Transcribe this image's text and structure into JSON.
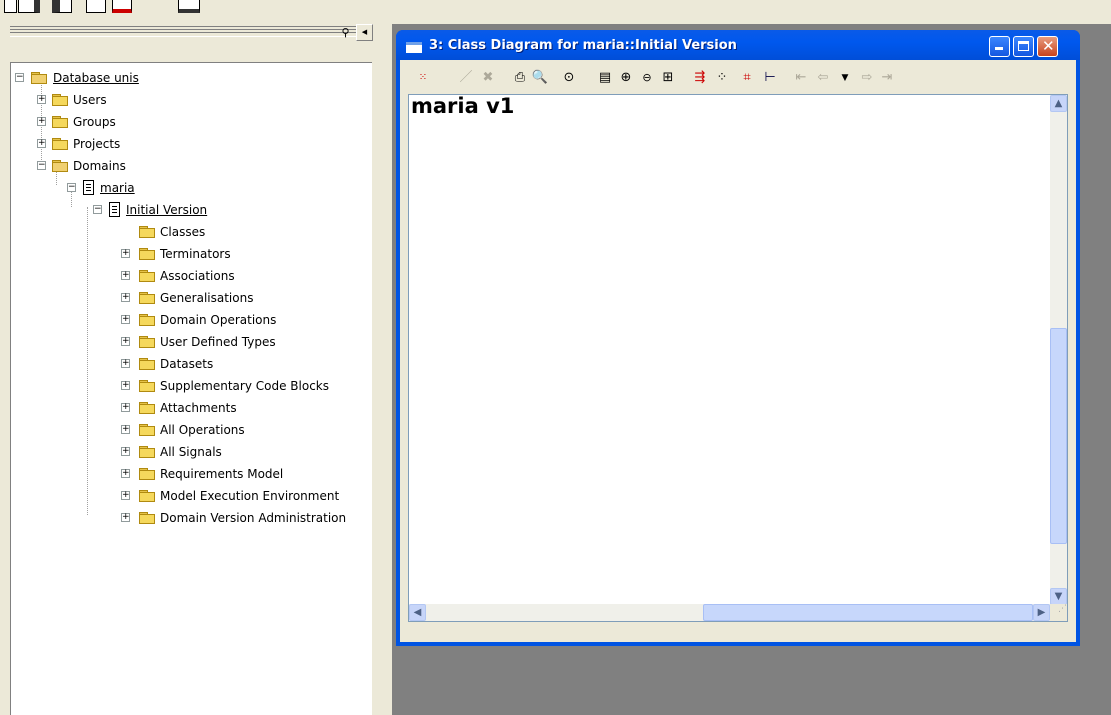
{
  "app_toolbar": {
    "buttons": [
      {
        "icon": "new-icon"
      },
      {
        "icon": "open-icon"
      },
      {
        "icon": "save-icon"
      },
      {
        "icon": "properties-icon"
      },
      {
        "icon": "delete-icon"
      },
      {
        "icon": "dropdown-icon"
      }
    ]
  },
  "left_pane": {
    "pin_icon": "pin-icon",
    "collapse_icon": "arrow-left-icon"
  },
  "tree": {
    "root": "Database unis",
    "users": "Users",
    "groups": "Groups",
    "projects": "Projects",
    "domains": "Domains",
    "domain": "maria",
    "version": "Initial Version",
    "children": [
      "Classes",
      "Terminators",
      "Associations",
      "Generalisations",
      "Domain Operations",
      "User Defined Types",
      "Datasets",
      "Supplementary Code Blocks",
      "Attachments",
      "All Operations",
      "All Signals",
      "Requirements Model",
      "Model Execution Environment",
      "Domain Version Administration"
    ]
  },
  "window": {
    "title": "3: Class Diagram for maria::Initial Version",
    "minimize_icon": "minimize-icon",
    "maximize_icon": "maximize-icon",
    "close_icon": "close-icon"
  },
  "diagram_toolbar": [
    {
      "icon": "select-mode-icon",
      "enabled": true
    },
    {
      "icon": "edit-icon",
      "enabled": false
    },
    {
      "icon": "delete-icon",
      "enabled": false
    },
    {
      "icon": "print-icon",
      "enabled": true
    },
    {
      "icon": "print-preview-icon",
      "enabled": true
    },
    {
      "icon": "find-icon",
      "enabled": true
    },
    {
      "icon": "properties-icon",
      "enabled": true
    },
    {
      "icon": "zoom-in-icon",
      "enabled": true
    },
    {
      "icon": "zoom-out-icon",
      "enabled": true
    },
    {
      "icon": "fit-icon",
      "enabled": true
    },
    {
      "icon": "layout-icon",
      "enabled": true
    },
    {
      "icon": "grid-icon",
      "enabled": true
    },
    {
      "icon": "snap-icon",
      "enabled": true
    },
    {
      "icon": "align-icon",
      "enabled": true
    },
    {
      "icon": "first-icon",
      "enabled": false
    },
    {
      "icon": "back-icon",
      "enabled": false
    },
    {
      "icon": "dropdown-icon",
      "enabled": true
    },
    {
      "icon": "forward-icon",
      "enabled": false
    },
    {
      "icon": "last-icon",
      "enabled": false
    }
  ],
  "diagram": {
    "title": "maria v1"
  }
}
